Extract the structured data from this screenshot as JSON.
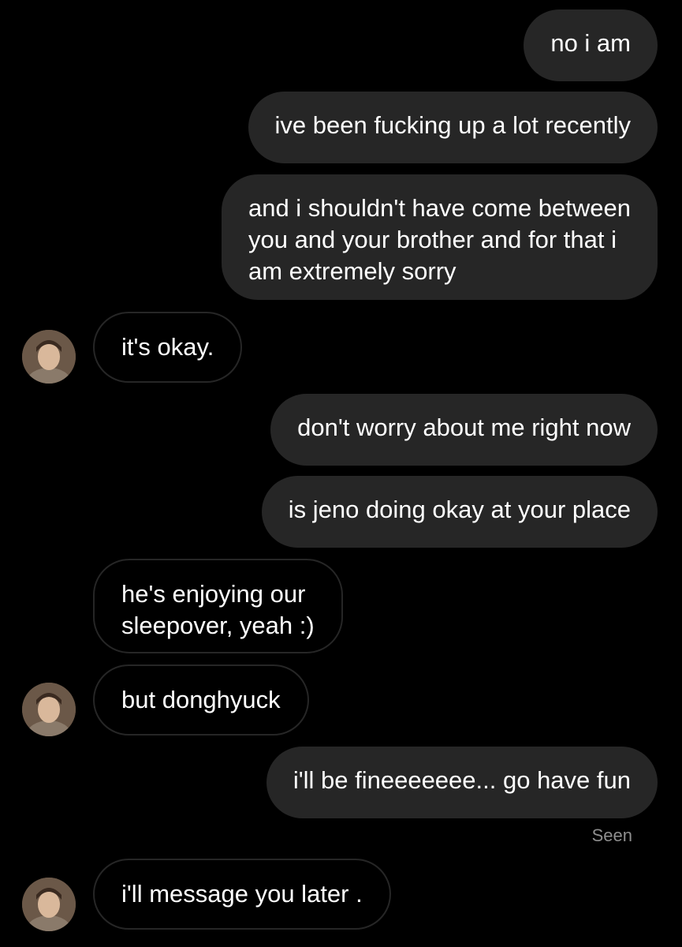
{
  "conversation": {
    "messages": [
      {
        "sender": "me",
        "text": "no i am"
      },
      {
        "sender": "me",
        "text": "ive been fucking up a lot recently"
      },
      {
        "sender": "me",
        "text": "and i shouldn't have come between\nyou and your brother and for that i\nam extremely sorry"
      },
      {
        "sender": "them",
        "text": "it's okay."
      },
      {
        "sender": "me",
        "text": "don't worry about me right now"
      },
      {
        "sender": "me",
        "text": "is jeno doing okay at your place"
      },
      {
        "sender": "them",
        "text": "he's enjoying our\nsleepover, yeah :)"
      },
      {
        "sender": "them",
        "text": "but donghyuck"
      },
      {
        "sender": "me",
        "text": "i'll be fineeeeeee... go have fun"
      },
      {
        "sender": "them",
        "text": "i'll message you later ."
      }
    ],
    "seen_label": "Seen"
  },
  "avatar": {
    "icon": "user-photo-icon"
  },
  "colors": {
    "background": "#000000",
    "outgoing_bubble": "#262626",
    "incoming_border": "#262626",
    "text": "#ffffff",
    "seen_text": "#8e8e8e"
  }
}
